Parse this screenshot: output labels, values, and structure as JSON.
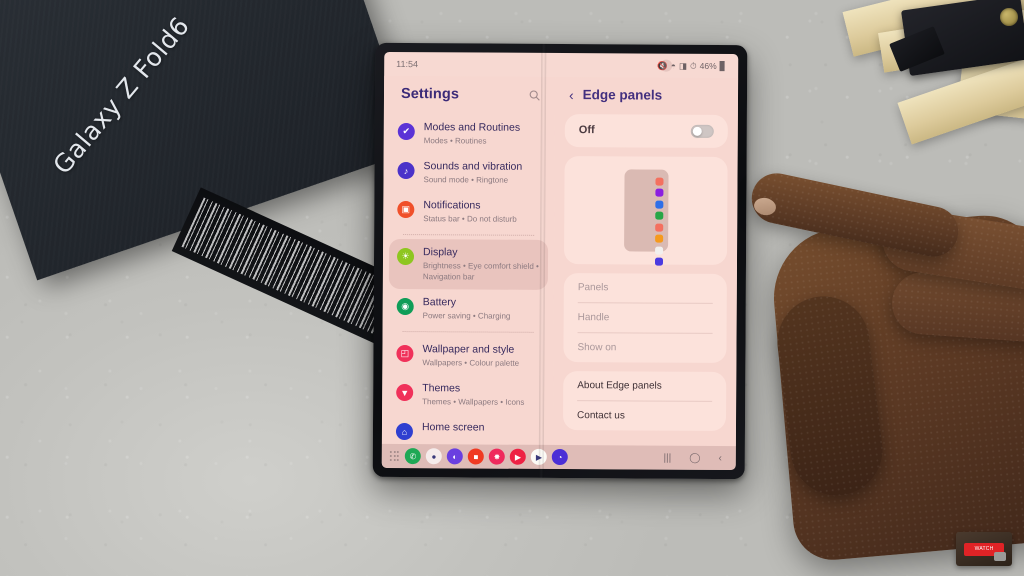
{
  "scene": {
    "box_label": "Galaxy Z Fold6",
    "watermark_text": "WATCH"
  },
  "status": {
    "time": "11:54",
    "battery": "46%",
    "icons": [
      "mute-icon",
      "wifi-icon",
      "signal-icon",
      "alarm-icon",
      "battery-icon"
    ]
  },
  "left_pane": {
    "title": "Settings",
    "search_icon": "search-icon",
    "items": [
      {
        "title": "Modes and Routines",
        "subtitle": "Modes  •  Routines",
        "color": "#5b33d6",
        "icon": "modes-icon",
        "selected": false
      },
      {
        "title": "Sounds and vibration",
        "subtitle": "Sound mode  •  Ringtone",
        "color": "#4b32c9",
        "icon": "sound-icon",
        "selected": false
      },
      {
        "title": "Notifications",
        "subtitle": "Status bar  •  Do not disturb",
        "color": "#f0502a",
        "icon": "notification-icon",
        "selected": false
      },
      {
        "title": "Display",
        "subtitle": "Brightness  •  Eye comfort shield  •  Navigation bar",
        "color": "#8ec620",
        "icon": "display-icon",
        "selected": true
      },
      {
        "title": "Battery",
        "subtitle": "Power saving  •  Charging",
        "color": "#0f9d58",
        "icon": "battery-icon",
        "selected": false
      },
      {
        "title": "Wallpaper and style",
        "subtitle": "Wallpapers  •  Colour palette",
        "color": "#f0315a",
        "icon": "wallpaper-icon",
        "selected": false
      },
      {
        "title": "Themes",
        "subtitle": "Themes  •  Wallpapers  •  Icons",
        "color": "#f0315a",
        "icon": "themes-icon",
        "selected": false
      },
      {
        "title": "Home screen",
        "subtitle": "",
        "color": "#2f3fd0",
        "icon": "home-screen-icon",
        "selected": false
      }
    ]
  },
  "right_pane": {
    "back_icon": "chevron-left-icon",
    "title": "Edge panels",
    "toggle": {
      "label": "Off",
      "on": false
    },
    "preview": {
      "dot_colors": [
        "#f4705f",
        "#8b1fe0",
        "#2f6fe8",
        "#28a646",
        "#f4705f",
        "#f59a1e",
        "#f2f0ee",
        "#4b3ae0"
      ]
    },
    "menu": [
      {
        "label": "Panels",
        "enabled": false
      },
      {
        "label": "Handle",
        "enabled": false
      },
      {
        "label": "Show on",
        "enabled": false
      }
    ],
    "menu2": [
      {
        "label": "About Edge panels",
        "enabled": true
      },
      {
        "label": "Contact us",
        "enabled": true
      }
    ]
  },
  "dock": {
    "apps_grid_icon": "apps-grid-icon",
    "apps": [
      {
        "name": "phone-app-icon",
        "color": "#1fa855",
        "glyph": "✆"
      },
      {
        "name": "messages-app-icon",
        "color": "#f6eceb",
        "glyph": "●"
      },
      {
        "name": "internet-app-icon",
        "color": "#6a3fe0",
        "glyph": "◐"
      },
      {
        "name": "gallery-app-icon",
        "color": "#f03a22",
        "glyph": "■"
      },
      {
        "name": "instagram-app-icon",
        "color": "#ef2a5c",
        "glyph": "✸"
      },
      {
        "name": "youtube-app-icon",
        "color": "#ee2244",
        "glyph": "▶"
      },
      {
        "name": "play-store-app-icon",
        "color": "#fdfbf6",
        "glyph": "▶"
      },
      {
        "name": "clock-app-icon",
        "color": "#4b2fd6",
        "glyph": "◔"
      }
    ],
    "nav": [
      {
        "name": "recents-button",
        "glyph": "|||"
      },
      {
        "name": "home-button",
        "glyph": "◯"
      },
      {
        "name": "back-button",
        "glyph": "‹"
      }
    ]
  }
}
